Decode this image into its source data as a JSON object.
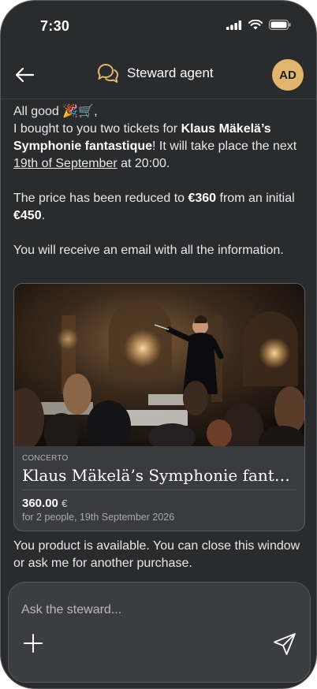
{
  "status_bar": {
    "time": "7:30"
  },
  "header": {
    "title": "Steward agent",
    "avatar_initials": "AD",
    "accent_color": "#e1b56f"
  },
  "message": {
    "greeting": "All good 🎉🛒,",
    "line1_pre": "I bought to you two tickets for ",
    "event_bold": "Klaus Mäkelä’s Symphonie fantastique",
    "line1_post": "! It will take place the next ",
    "date_link": "19th of September",
    "line1_end": " at 20:00.",
    "price_pre": "The price has been reduced to ",
    "price_new": "€360",
    "price_mid": " from an initial ",
    "price_old": "€450",
    "price_end": ".",
    "email_note": "You will receive an email with all the information."
  },
  "card": {
    "category": "CONCERTO",
    "title": "Klaus Mäkelä’s Symphonie fantastique",
    "price_value": "360.00",
    "price_currency": "€",
    "subtitle": "for 2 people, 19th September 2026"
  },
  "after_message": "You product is available. You can close this window or ask me for another purchase.",
  "composer": {
    "placeholder": "Ask the steward..."
  }
}
